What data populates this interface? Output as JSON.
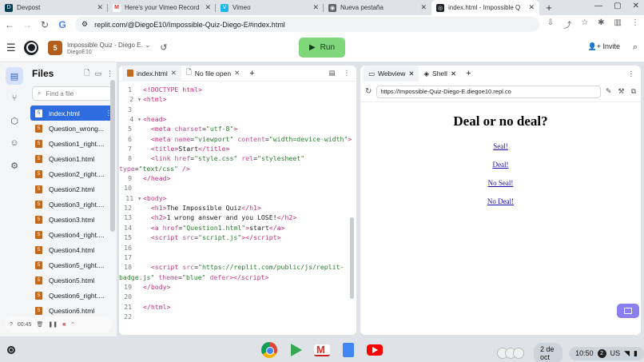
{
  "browser": {
    "tabs": [
      {
        "title": "Devpost",
        "icon": "devpost-icon",
        "color": "#003e54"
      },
      {
        "title": "Here's your Vimeo Record insi",
        "icon": "gmail-icon",
        "color": "#d93025"
      },
      {
        "title": "Vimeo",
        "icon": "vimeo-icon",
        "color": "#1ab7ea"
      },
      {
        "title": "Nueva pestaña",
        "icon": "globe-icon",
        "color": "#5f6368"
      },
      {
        "title": "index.html - Impossible Q",
        "icon": "replit-icon",
        "color": "#1c1f24",
        "active": true
      }
    ],
    "url": "replit.com/@DiegoE10/Impossible-Quiz-Diego-E#index.html"
  },
  "header": {
    "project_name": "Impossible Quiz - Diego E.",
    "owner": "DiegoE10",
    "run_label": "Run",
    "invite_label": "Invite"
  },
  "files": {
    "title": "Files",
    "search_placeholder": "Find a file",
    "items": [
      "index.html",
      "Question_wrong...",
      "Question1_right....",
      "Question1.html",
      "Question2_right....",
      "Question2.html",
      "Question3_right....",
      "Question3.html",
      "Question4_right....",
      "Question4.html",
      "Question5_right....",
      "Question5.html",
      "Question6_right....",
      "Question6.html"
    ],
    "selected_index": 0
  },
  "video_controls": {
    "time": "00:45"
  },
  "editor": {
    "tabs": [
      {
        "label": "index.html"
      },
      {
        "label": "No file open"
      }
    ],
    "lines": [
      {
        "n": "1",
        "html": "<span class='tag'>&lt;!DOCTYPE html&gt;</span>"
      },
      {
        "n": "2",
        "fold": true,
        "html": "<span class='tag'>&lt;html&gt;</span>"
      },
      {
        "n": "3",
        "html": ""
      },
      {
        "n": "4",
        "fold": true,
        "html": "<span class='tag'>&lt;head&gt;</span>"
      },
      {
        "n": "5",
        "html": "  <span class='tag'>&lt;meta</span> <span class='attr'>charset</span>=<span class='str'>\"utf-8\"</span><span class='tag'>&gt;</span>"
      },
      {
        "n": "6",
        "html": "  <span class='tag'>&lt;meta</span> <span class='attr'>name</span>=<span class='str'>\"viewport\"</span> <span class='attr'>content</span>=<span class='str'>\"width=device-width\"</span><span class='tag'>&gt;</span>"
      },
      {
        "n": "7",
        "html": "  <span class='tag'>&lt;title&gt;</span><span class='txt'>Start</span><span class='tag'>&lt;/title&gt;</span>"
      },
      {
        "n": "8",
        "html": "  <span class='tag'>&lt;link</span> <span class='attr'>href</span>=<span class='str'>\"style.css\"</span> <span class='attr'>rel</span>=<span class='str'>\"stylesheet\"</span>"
      },
      {
        "n": "",
        "html": "<span class='attr'>type</span>=<span class='str'>\"text/css\"</span> <span class='tag'>/&gt;</span>"
      },
      {
        "n": "9",
        "html": "<span class='tag'>&lt;/head&gt;</span>"
      },
      {
        "n": "10",
        "html": ""
      },
      {
        "n": "11",
        "fold": true,
        "html": "<span class='tag'>&lt;body&gt;</span>"
      },
      {
        "n": "12",
        "html": "  <span class='tag'>&lt;h1&gt;</span><span class='txt'>The Impossible Quiz</span><span class='tag'>&lt;/h1&gt;</span>"
      },
      {
        "n": "13",
        "html": "  <span class='tag'>&lt;h2&gt;</span><span class='txt'>1 wrong answer and you LOSE!</span><span class='tag'>&lt;/h2&gt;</span>"
      },
      {
        "n": "14",
        "html": "  <span class='tag'>&lt;a</span> <span class='attr'>href</span>=<span class='str'>\"Question1.html\"</span><span class='tag'>&gt;</span><span class='txt'>start</span><span class='tag'>&lt;/a&gt;</span>"
      },
      {
        "n": "15",
        "html": "  <span class='tag'>&lt;script</span> <span class='attr'>src</span>=<span class='str'>\"script.js\"</span><span class='tag'>&gt;&lt;/script&gt;</span>"
      },
      {
        "n": "16",
        "html": ""
      },
      {
        "n": "17",
        "html": ""
      },
      {
        "n": "18",
        "html": "  <span class='tag'>&lt;script</span> <span class='attr'>src</span>=<span class='str'>\"https://replit.com/public/js/replit-</span>"
      },
      {
        "n": "",
        "html": "<span class='str'>badge.js\"</span> <span class='attr'>theme</span>=<span class='str'>\"blue\"</span> <span class='attr'>defer</span><span class='tag'>&gt;&lt;/script&gt;</span>"
      },
      {
        "n": "19",
        "html": "<span class='tag'>&lt;/body&gt;</span>"
      },
      {
        "n": "20",
        "html": ""
      },
      {
        "n": "21",
        "html": "<span class='tag'>&lt;/html&gt;</span>"
      },
      {
        "n": "22",
        "html": ""
      }
    ]
  },
  "webview": {
    "tabs": [
      {
        "label": "Webview"
      },
      {
        "label": "Shell"
      }
    ],
    "url": "https://Impossible-Quiz-Diego-E.diegoe10.repl.co",
    "heading": "Deal or no deal?",
    "links": [
      "Seal!",
      "Deal!",
      "No Seal!",
      "No Deal!"
    ]
  },
  "shelf": {
    "date": "2 de oct",
    "time": "10:50",
    "notifications": "2",
    "locale": "US"
  }
}
